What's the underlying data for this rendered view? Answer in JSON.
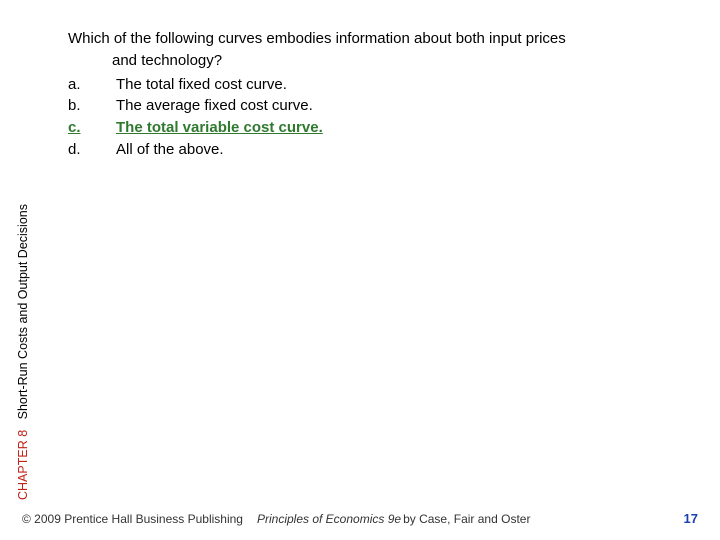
{
  "question": {
    "line1": "Which of the following curves embodies information about both input prices",
    "line2": "and technology?"
  },
  "options": {
    "a": {
      "letter": "a.",
      "text": "The total fixed cost curve."
    },
    "b": {
      "letter": "b.",
      "text": "The average fixed cost curve."
    },
    "c": {
      "letter": "c.",
      "text": "The total variable cost curve."
    },
    "d": {
      "letter": "d.",
      "text": "All of the above."
    }
  },
  "side": {
    "chapter": "CHAPTER 8",
    "title": "Short-Run Costs and Output Decisions"
  },
  "footer": {
    "copyright": "© 2009 Prentice Hall Business Publishing",
    "book": "Principles of Economics 9e",
    "authors": "by Case, Fair and Oster",
    "page": "17"
  }
}
